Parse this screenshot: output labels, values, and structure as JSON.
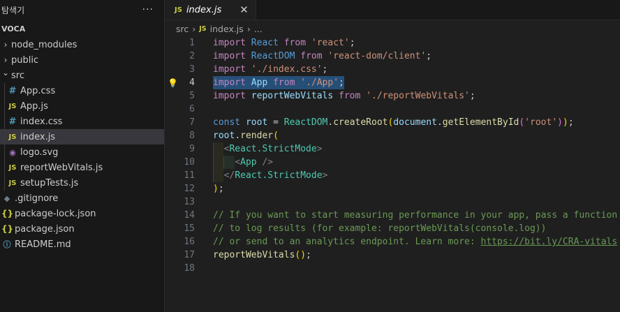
{
  "explorer": {
    "title": "탐색기",
    "more": "···",
    "workspace": "VOCA",
    "items": [
      {
        "label": "node_modules",
        "type": "folder",
        "expanded": false,
        "depth": 0
      },
      {
        "label": "public",
        "type": "folder",
        "expanded": false,
        "depth": 0
      },
      {
        "label": "src",
        "type": "folder",
        "expanded": true,
        "depth": 0
      },
      {
        "label": "App.css",
        "type": "css",
        "depth": 1
      },
      {
        "label": "App.js",
        "type": "js",
        "depth": 1
      },
      {
        "label": "index.css",
        "type": "css",
        "depth": 1
      },
      {
        "label": "index.js",
        "type": "js",
        "depth": 1,
        "selected": true
      },
      {
        "label": "logo.svg",
        "type": "svg",
        "depth": 1
      },
      {
        "label": "reportWebVitals.js",
        "type": "js",
        "depth": 1
      },
      {
        "label": "setupTests.js",
        "type": "js",
        "depth": 1
      },
      {
        "label": ".gitignore",
        "type": "git",
        "depth": 0
      },
      {
        "label": "package-lock.json",
        "type": "json",
        "depth": 0
      },
      {
        "label": "package.json",
        "type": "json",
        "depth": 0
      },
      {
        "label": "README.md",
        "type": "info",
        "depth": 0
      }
    ]
  },
  "tab": {
    "badge": "JS",
    "name": "index.js",
    "close": "✕"
  },
  "breadcrumb": {
    "folder": "src",
    "badge": "JS",
    "file": "index.js",
    "rest": "..."
  },
  "editor": {
    "active_line": 4,
    "line_numbers": [
      "1",
      "2",
      "3",
      "4",
      "5",
      "6",
      "7",
      "8",
      "9",
      "10",
      "11",
      "12",
      "13",
      "14",
      "15",
      "16",
      "17",
      "18"
    ],
    "lines": [
      [
        "import",
        " ",
        "React",
        " ",
        "from",
        " ",
        "'react'",
        ";"
      ],
      [
        "import",
        " ",
        "ReactDOM",
        " ",
        "from",
        " ",
        "'react-dom/client'",
        ";"
      ],
      [
        "import",
        " ",
        "'./index.css'",
        ";"
      ],
      [
        "import",
        " ",
        "App",
        " ",
        "from",
        " ",
        "'./App'",
        ";"
      ],
      [
        "import",
        " ",
        "reportWebVitals",
        " ",
        "from",
        " ",
        "'./reportWebVitals'",
        ";"
      ],
      [],
      [
        "const",
        " ",
        "root",
        " = ",
        "ReactDOM",
        ".",
        "createRoot",
        "(",
        "document",
        ".",
        "getElementById",
        "(",
        "'root'",
        ")",
        ")",
        ";"
      ],
      [
        "root",
        ".",
        "render",
        "("
      ],
      [
        "  ",
        "<",
        "React.StrictMode",
        ">"
      ],
      [
        "    ",
        "<",
        "App",
        " />"
      ],
      [
        "  ",
        "</",
        "React.StrictMode",
        ">"
      ],
      [
        ")",
        ";"
      ],
      [],
      [
        "// If you want to start measuring performance in your app, pass a function"
      ],
      [
        "// to log results (for example: reportWebVitals(console.log))"
      ],
      [
        "// or send to an analytics endpoint. Learn more: ",
        "https://bit.ly/CRA-vitals"
      ],
      [
        "reportWebVitals",
        "(",
        ")",
        ";"
      ],
      []
    ]
  }
}
